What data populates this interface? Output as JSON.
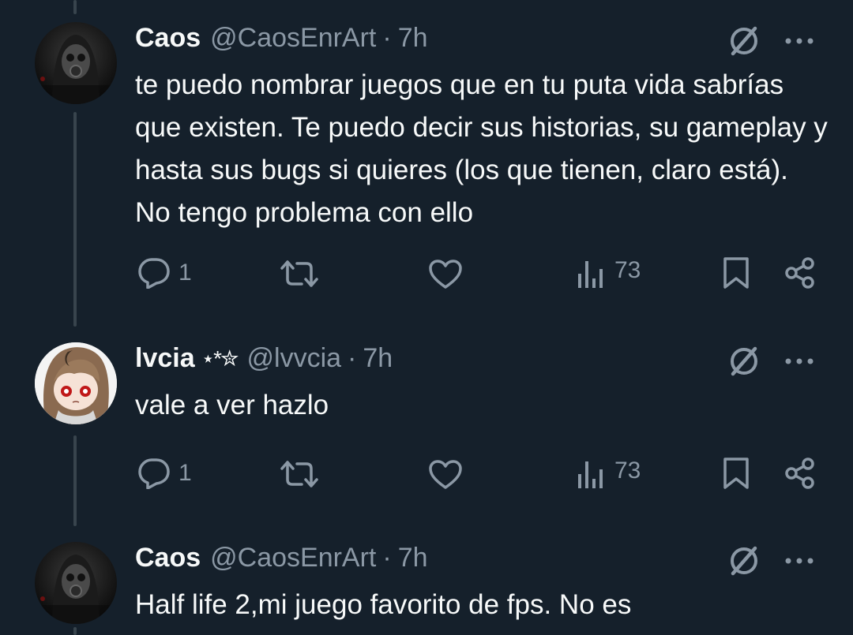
{
  "colors": {
    "background": "#15202b",
    "text": "#f7f9f9",
    "secondary": "#8b98a5",
    "thread_line": "#38444d"
  },
  "icons": {
    "reply": "reply-icon",
    "retweet": "retweet-icon",
    "like": "heart-icon",
    "views": "views-chart-icon",
    "bookmark": "bookmark-icon",
    "share": "share-icon",
    "grok": "grok-slash-icon",
    "more": "more-dots-icon"
  },
  "tweets": [
    {
      "name": "Caos",
      "name_decoration": "",
      "handle": "@CaosEnrArt",
      "separator": "·",
      "time": "7h",
      "text": "te puedo nombrar juegos que en tu puta vida sabrías que existen. Te puedo decir sus historias, su gameplay y hasta sus bugs si quieres (los que tienen, claro está). No tengo problema con ello",
      "replies": "1",
      "retweets": "",
      "likes": "",
      "views": "73"
    },
    {
      "name": "lvcia",
      "name_decoration": "⋆*✮",
      "handle": "@lvvcia",
      "separator": "·",
      "time": "7h",
      "text": "vale a ver hazlo",
      "replies": "1",
      "retweets": "",
      "likes": "",
      "views": "73"
    },
    {
      "name": "Caos",
      "name_decoration": "",
      "handle": "@CaosEnrArt",
      "separator": "·",
      "time": "7h",
      "text": "Half life 2,mi juego favorito de fps. No es"
    }
  ]
}
